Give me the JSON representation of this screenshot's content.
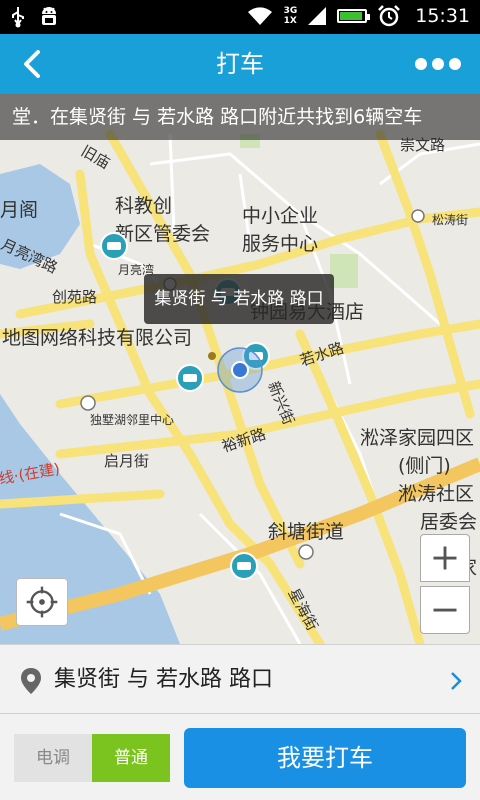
{
  "status_bar": {
    "time": "15:31",
    "network_top": "3G",
    "network_bottom": "1X"
  },
  "app_bar": {
    "title": "打车"
  },
  "map": {
    "banner": "堂．在集贤街 与 若水路 路口附近共找到6辆空车",
    "tooltip": "集贤街 与 若水路 路口",
    "labels": {
      "kejiao": "科教创",
      "xinqu": "新区管委会",
      "zhongxiao": "中小企业",
      "fuwu": "服务中心",
      "jiudian": "钟园易大酒店",
      "tuwang": "地图网络科技有限公司",
      "ruoshui": "若水路",
      "xinxing": "新兴街",
      "yuxin": "裕新路",
      "qiyue": "启月街",
      "linli": "独墅湖邻里中心",
      "songze1": "淞泽家园四区",
      "songze2": "(侧门)",
      "songtao1": "淞涛社区",
      "songtao2": "居委会",
      "xietang": "斜塘街道",
      "chuangyuan": "创苑路",
      "yueliangwan": "月亮湾",
      "chongwen": "崇文路",
      "songtaojie": "松涛街",
      "xiaojie": "星海街",
      "jiumiao": "旧庙",
      "yue": "月阁",
      "dang": "堂",
      "yuehuwan": "月亮湾路",
      "tiaoxian": "线·(在建)",
      "jia": "家"
    }
  },
  "address_bar": {
    "address": "集贤街 与 若水路 路口"
  },
  "bottom": {
    "mode_ac": "电调",
    "mode_normal": "普通",
    "call_button": "我要打车"
  }
}
